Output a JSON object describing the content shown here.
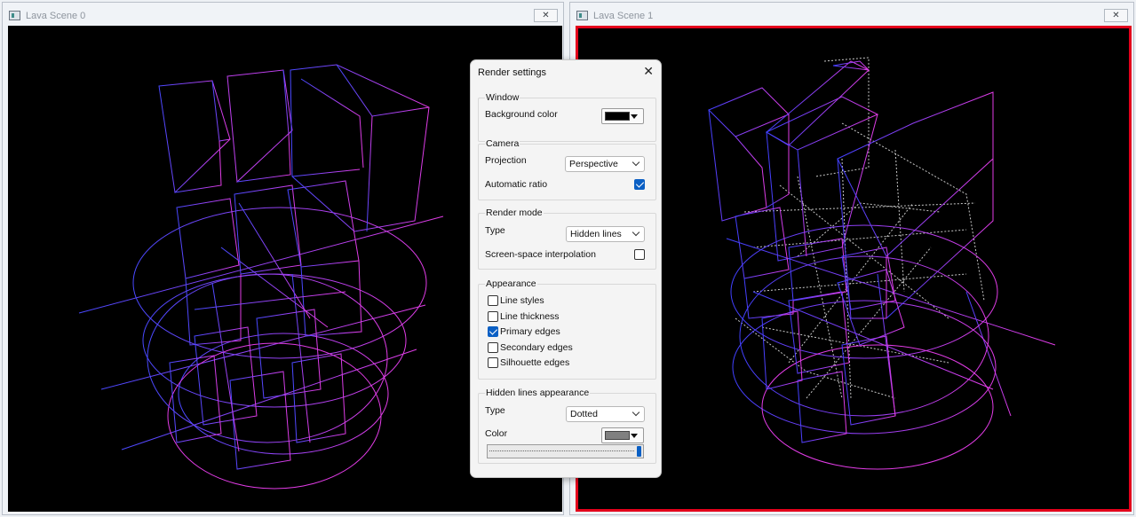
{
  "windows": [
    {
      "title": "Lava Scene 0",
      "close": "✕"
    },
    {
      "title": "Lava Scene 1",
      "close": "✕"
    }
  ],
  "dialog": {
    "title": "Render settings",
    "close": "✕",
    "window_group": {
      "title": "Window",
      "background_color_label": "Background color",
      "background_color": "#000000"
    },
    "camera_group": {
      "title": "Camera",
      "projection_label": "Projection",
      "projection_value": "Perspective",
      "automatic_ratio_label": "Automatic ratio",
      "automatic_ratio": true
    },
    "render_mode_group": {
      "title": "Render mode",
      "type_label": "Type",
      "type_value": "Hidden lines",
      "ssi_label": "Screen-space interpolation",
      "ssi": false
    },
    "appearance_group": {
      "title": "Appearance",
      "items": [
        {
          "label": "Line styles",
          "checked": false
        },
        {
          "label": "Line thickness",
          "checked": false
        },
        {
          "label": "Primary edges",
          "checked": true
        },
        {
          "label": "Secondary edges",
          "checked": false
        },
        {
          "label": "Silhouette edges",
          "checked": false
        }
      ]
    },
    "hidden_group": {
      "title": "Hidden lines appearance",
      "type_label": "Type",
      "type_value": "Dotted",
      "color_label": "Color",
      "color": "#808080",
      "slider_value": 1.0
    }
  },
  "colors": {
    "accent": "#0a5fc4",
    "active_border": "#e3001b",
    "wire_pink": "#e040e8",
    "wire_blue": "#4040ff"
  }
}
